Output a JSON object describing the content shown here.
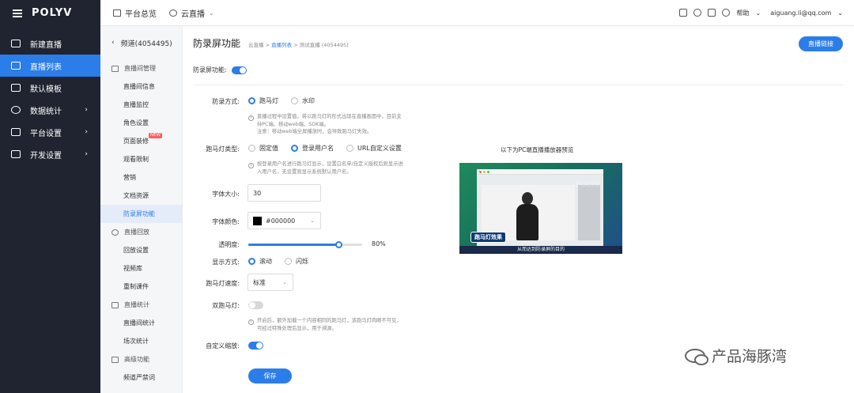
{
  "sidebar": {
    "brand": "POLYV",
    "items": [
      {
        "label": "新建直播",
        "icon": "video-camera-icon",
        "arrow": ""
      },
      {
        "label": "直播列表",
        "icon": "list-icon",
        "arrow": "",
        "active": true
      },
      {
        "label": "默认模板",
        "icon": "template-icon",
        "arrow": ""
      },
      {
        "label": "数据统计",
        "icon": "chart-icon",
        "arrow": "›"
      },
      {
        "label": "平台设置",
        "icon": "layers-icon",
        "arrow": "›"
      },
      {
        "label": "开发设置",
        "icon": "code-icon",
        "arrow": "›"
      }
    ]
  },
  "topbar": {
    "overview": "平台总览",
    "cloud_live": "云直播",
    "help": "帮助",
    "email": "aiguang.li@qq.com"
  },
  "subnav": {
    "back": "频道(4054495)",
    "group1": "直播间管理",
    "group1_items": [
      "直播间信息",
      "直播监控",
      "角色设置",
      "页面装修",
      "观看限制",
      "营销",
      "文档资源",
      "防录屏功能"
    ],
    "new_badge": "NEW",
    "group2": "直播回放",
    "group2_items": [
      "回放设置",
      "视频库",
      "重制课件"
    ],
    "group3": "直播统计",
    "group3_items": [
      "直播间统计",
      "场次统计"
    ],
    "group4": "高级功能",
    "group4_items": [
      "频道严禁词"
    ]
  },
  "main": {
    "title": "防录屏功能",
    "crumb_1": "云直播 > ",
    "crumb_2": "直播列表",
    "crumb_3": " > 测试直播 (4054495)",
    "link_button": "直播链接",
    "master_label": "防录屏功能:",
    "mode_label": "防录方式:",
    "mode_options": [
      "跑马灯",
      "水印"
    ],
    "mode_hint_1": "直播过程中设置值，将以跑马灯的形式出现在直播画面中，目前支",
    "mode_hint_2": "持PC端、移动web端、SDK端。",
    "mode_hint_3": "注意：移动web端全屏播放时，会导致跑马灯失效。",
    "type_label": "跑马灯类型:",
    "type_options": [
      "固定值",
      "登录用户名",
      "URL自定义设置"
    ],
    "type_hint_1": "按登录用户名进行跑马灯显示，设置白名单/自定义授权后则显示进",
    "type_hint_2": "入用户名，无设置则显示系统默认用户名。",
    "font_size_label": "字体大小:",
    "font_size_value": "30",
    "font_color_label": "字体颜色:",
    "font_color_value": "#000000",
    "opacity_label": "透明度:",
    "opacity_value": "80%",
    "opacity_fraction": 0.8,
    "display_label": "显示方式:",
    "display_options": [
      "滚动",
      "闪烁"
    ],
    "speed_label": "跑马灯速度:",
    "speed_value": "标准",
    "double_label": "双跑马灯:",
    "double_hint_1": "开启后，额外加载一个内容相同的跑马灯，该跑马灯肉眼不可见，",
    "double_hint_2": "可经过特殊处理后显示，用于溯源。",
    "custom_label": "自定义缩放:",
    "save_button": "保存",
    "preview_caption": "以下为PC端直播播放器预览",
    "preview_badge": "跑马灯效果",
    "preview_subtitle": "从而达到防录屏的目的",
    "preview_watermark": "POLYV"
  },
  "watermark": "产品海豚湾",
  "colors": {
    "accent": "#2b7de9",
    "sidebar_bg": "#1f2430"
  }
}
